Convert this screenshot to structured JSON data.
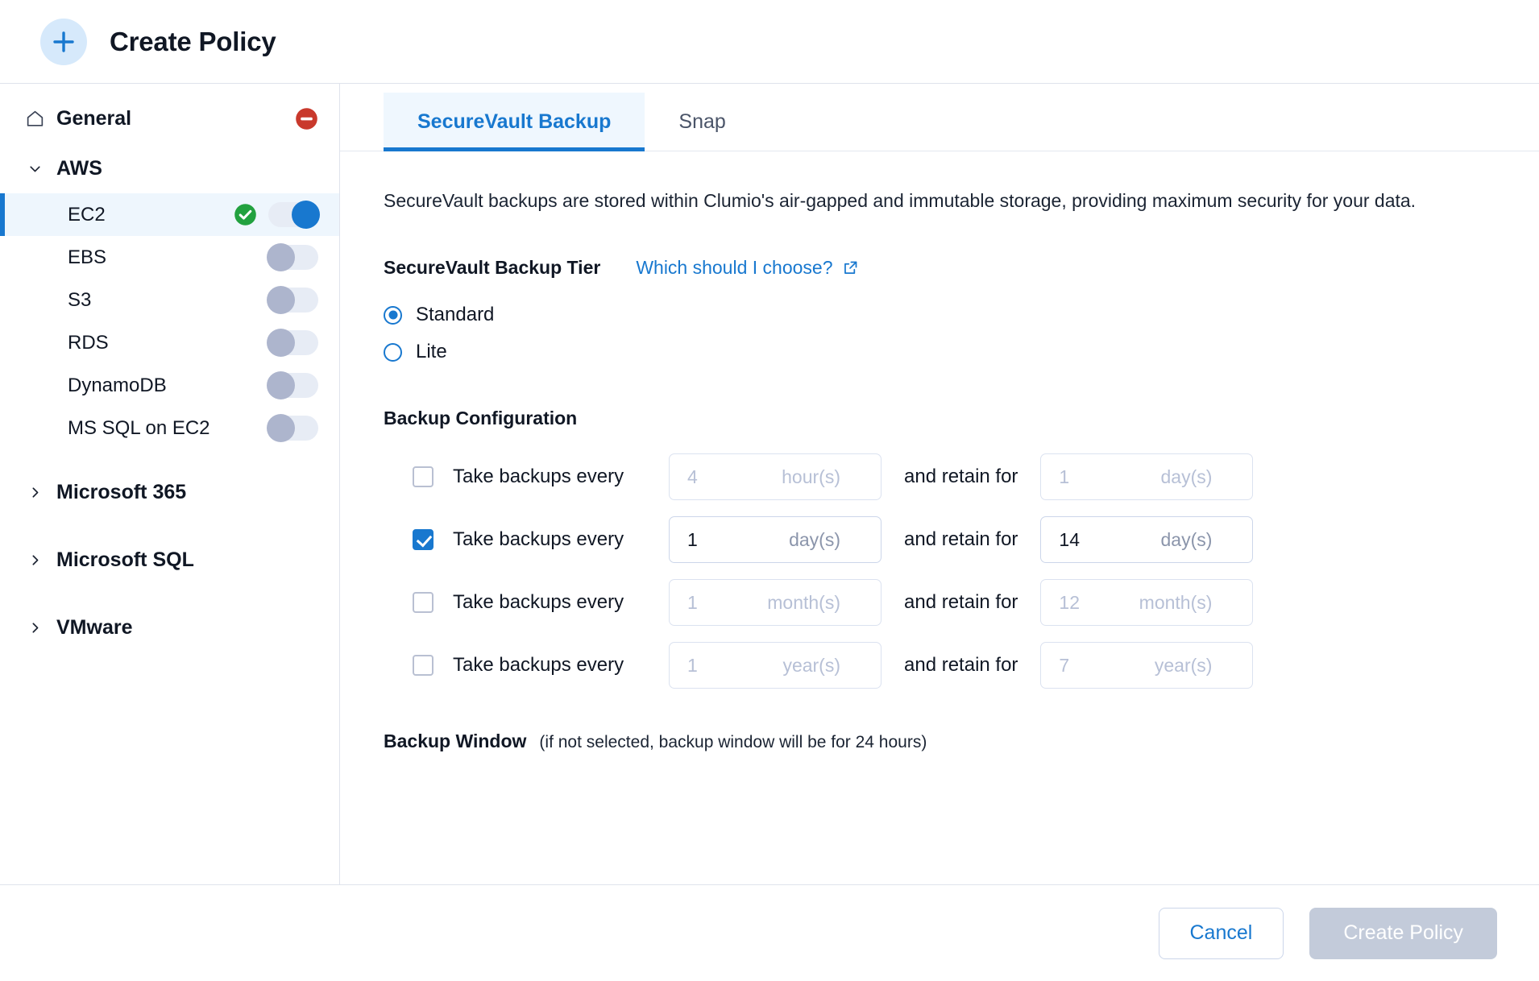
{
  "header": {
    "title": "Create Policy",
    "add_icon": "plus-icon"
  },
  "sidebar": {
    "general": {
      "label": "General",
      "icon": "home-icon",
      "status_icon": "error-minus-icon"
    },
    "groups": [
      {
        "label": "AWS",
        "expanded": true,
        "chevron": "chevron-down-icon",
        "children": [
          {
            "label": "EC2",
            "selected": true,
            "toggle": "on",
            "status_icon": "success-check-icon"
          },
          {
            "label": "EBS",
            "selected": false,
            "toggle": "off"
          },
          {
            "label": "S3",
            "selected": false,
            "toggle": "off"
          },
          {
            "label": "RDS",
            "selected": false,
            "toggle": "off"
          },
          {
            "label": "DynamoDB",
            "selected": false,
            "toggle": "off"
          },
          {
            "label": "MS SQL on EC2",
            "selected": false,
            "toggle": "off"
          }
        ]
      },
      {
        "label": "Microsoft 365",
        "expanded": false,
        "chevron": "chevron-right-icon",
        "children": []
      },
      {
        "label": "Microsoft SQL",
        "expanded": false,
        "chevron": "chevron-right-icon",
        "children": []
      },
      {
        "label": "VMware",
        "expanded": false,
        "chevron": "chevron-right-icon",
        "children": []
      }
    ]
  },
  "main": {
    "tabs": [
      {
        "label": "SecureVault Backup",
        "active": true
      },
      {
        "label": "Snap",
        "active": false
      }
    ],
    "intro": "SecureVault backups are stored within Clumio's air-gapped and immutable storage, providing maximum security for your data.",
    "tier": {
      "title": "SecureVault Backup Tier",
      "help_link": "Which should I choose?",
      "help_icon": "external-link-icon",
      "options": [
        {
          "label": "Standard",
          "selected": true
        },
        {
          "label": "Lite",
          "selected": false
        }
      ]
    },
    "backup_configuration": {
      "title": "Backup Configuration",
      "every_label": "Take backups every",
      "retain_label": "and retain for",
      "rows": [
        {
          "checked": false,
          "every": {
            "value": "4",
            "unit": "hour(s)"
          },
          "retain": {
            "value": "1",
            "unit": "day(s)"
          }
        },
        {
          "checked": true,
          "every": {
            "value": "1",
            "unit": "day(s)"
          },
          "retain": {
            "value": "14",
            "unit": "day(s)"
          }
        },
        {
          "checked": false,
          "every": {
            "value": "1",
            "unit": "month(s)"
          },
          "retain": {
            "value": "12",
            "unit": "month(s)"
          }
        },
        {
          "checked": false,
          "every": {
            "value": "1",
            "unit": "year(s)"
          },
          "retain": {
            "value": "7",
            "unit": "year(s)"
          }
        }
      ]
    },
    "backup_window": {
      "title": "Backup Window",
      "note": "(if not selected, backup window will be for 24 hours)"
    }
  },
  "footer": {
    "cancel_label": "Cancel",
    "create_label": "Create Policy"
  },
  "colors": {
    "accent_blue": "#1878cf",
    "success_green": "#22a13f",
    "error_red": "#c9392c",
    "disabled_gray": "#c3cbda",
    "toggle_off_knob": "#adb5cd"
  }
}
